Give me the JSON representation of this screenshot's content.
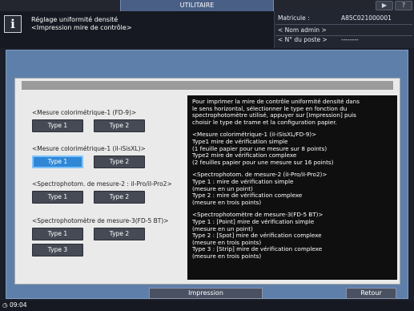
{
  "top_bar": {
    "title": "UTILITAIRE",
    "speaker_icon": "speaker-icon",
    "help_label": "?"
  },
  "header": {
    "info_icon_glyph": "i",
    "title_line1": "Réglage uniformité densité",
    "title_line2": "<Impression mire de contrôle>"
  },
  "right_panel": {
    "serial_label": "Matricule  :",
    "serial_value": "A85C021000001",
    "admin_label": "< Nom admin >",
    "station_label": "< N° du poste >",
    "station_value": "--------"
  },
  "groups": [
    {
      "label": "<Mesure colorimétrique-1 (FD-9)>",
      "buttons": [
        "Type 1",
        "Type 2"
      ]
    },
    {
      "label": "<Mesure colorimétrique-1 (iI-iSisXL)>",
      "buttons": [
        "Type 1",
        "Type 2"
      ]
    },
    {
      "label": "<Spectrophotom. de mesure-2 : iI-Pro/iI-Pro2>",
      "buttons": [
        "Type 1",
        "Type 2"
      ]
    },
    {
      "label": "<Spectrophotomètre de mesure-3(FD-5 BT)>",
      "buttons": [
        "Type 1",
        "Type 2",
        "Type 3"
      ]
    }
  ],
  "selected": {
    "group": 1,
    "button": 0
  },
  "description": [
    "Pour imprimer la mire de contrôle uniformité densité dans\nle sens horizontal, sélectionner le type en fonction du\nspectrophotomètre utilisé, appuyer sur [Impression] puis\nchoisir le type de trame et la configuration papier.",
    "<Mesure colorimétrique-1 (iI-iSisXL/FD-9)>\nType1 mire de vérification simple\n(1 feuille papier pour une mesure sur 8 points)\nType2 mire de vérification complexe\n(2 feuilles papier pour une mesure sur 16 points)",
    "<Spectrophotom. de mesure-2 (iI-Pro/iI-Pro2)>\nType 1 : mire de vérification simple\n(mesure en un point)\nType 2 : mire de vérification complexe\n(mesure en trois points)",
    "<Spectrophotomètre de mesure-3(FD-5 BT)>\nType 1 : [Point] mire de vérification simple\n(mesure en un point)\nType 2 : [Spot] mire de vérification complexe\n(mesure en trois points)\nType 3 : [Strip] mire de vérification complexe\n(mesure en trois points)"
  ],
  "bottom": {
    "print_label": "Impression",
    "back_label": "Retour"
  },
  "status": {
    "time": "09:04"
  },
  "colors": {
    "frame_blue": "#5e7faa",
    "selected_blue": "#2f87d6",
    "title_tab": "#4a5f86"
  }
}
